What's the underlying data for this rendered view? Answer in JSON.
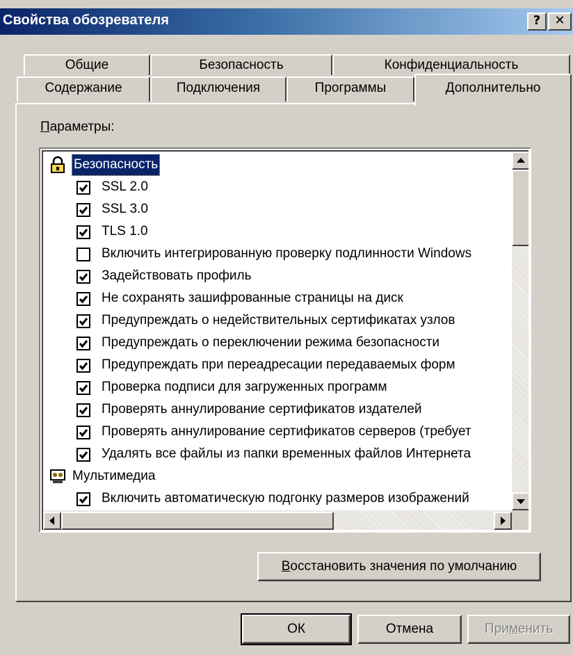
{
  "window": {
    "title": "Свойства обозревателя",
    "help_label": "?",
    "close_label": "✕"
  },
  "tabs": {
    "back": [
      "Общие",
      "Безопасность",
      "Конфиденциальность"
    ],
    "front": [
      "Содержание",
      "Подключения",
      "Программы",
      "Дополнительно"
    ],
    "active": "Дополнительно"
  },
  "params": {
    "label_first": "П",
    "label_rest": "араметры:"
  },
  "list": {
    "items": [
      {
        "type": "group",
        "icon": "lock-icon",
        "label": "Безопасность"
      },
      {
        "type": "check",
        "checked": true,
        "label": "SSL 2.0"
      },
      {
        "type": "check",
        "checked": true,
        "label": "SSL 3.0"
      },
      {
        "type": "check",
        "checked": true,
        "label": "TLS 1.0"
      },
      {
        "type": "check",
        "checked": false,
        "label": "Включить интегрированную проверку подлинности Windows"
      },
      {
        "type": "check",
        "checked": true,
        "label": "Задействовать профиль"
      },
      {
        "type": "check",
        "checked": true,
        "label": "Не сохранять зашифрованные страницы на диск"
      },
      {
        "type": "check",
        "checked": true,
        "label": "Предупреждать о недействительных сертификатах узлов"
      },
      {
        "type": "check",
        "checked": true,
        "label": "Предупреждать о переключении режима безопасности"
      },
      {
        "type": "check",
        "checked": true,
        "label": "Предупреждать при переадресации передаваемых форм"
      },
      {
        "type": "check",
        "checked": true,
        "label": "Проверка подписи для загруженных программ"
      },
      {
        "type": "check",
        "checked": true,
        "label": "Проверять аннулирование сертификатов издателей"
      },
      {
        "type": "check",
        "checked": true,
        "label": "Проверять аннулирование сертификатов серверов (требует"
      },
      {
        "type": "check",
        "checked": true,
        "label": "Удалять все файлы из папки временных файлов Интернета"
      },
      {
        "type": "group",
        "icon": "multimedia-icon",
        "label": "Мультимедиа"
      },
      {
        "type": "check",
        "checked": true,
        "label": "Включить автоматическую подгонку размеров изображений"
      }
    ]
  },
  "buttons": {
    "restore_first": "В",
    "restore_rest": "осстановить значения по умолчанию",
    "ok": "ОК",
    "cancel": "Отмена",
    "apply_a": "При",
    "apply_u": "м",
    "apply_b": "енить"
  },
  "colors": {
    "face": "#d4d0c8",
    "title_dark": "#0a246a",
    "title_light": "#a6caf0",
    "selection": "#0a246a"
  }
}
